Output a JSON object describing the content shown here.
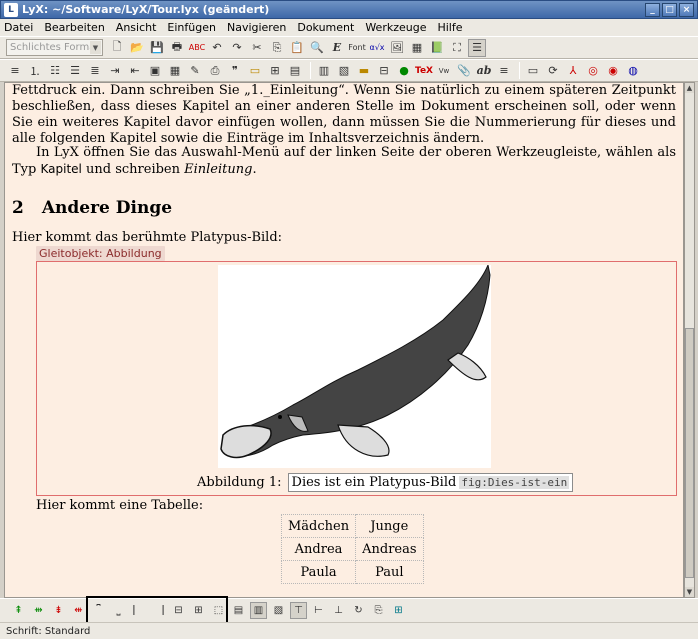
{
  "window": {
    "title": "LyX: ~/Software/LyX/Tour.lyx (geändert)",
    "controls": [
      "_",
      "□",
      "×"
    ]
  },
  "menu": [
    "Datei",
    "Bearbeiten",
    "Ansicht",
    "Einfügen",
    "Navigieren",
    "Dokument",
    "Werkzeuge",
    "Hilfe"
  ],
  "toolbar": {
    "style_combo": "Schlichtes Format",
    "row1_icons": [
      "new-file-icon",
      "open-file-icon",
      "save-icon",
      "print-icon",
      "spellcheck-icon",
      "undo-icon",
      "redo-icon",
      "cut-icon",
      "copy-icon",
      "paste-icon",
      "find-replace-icon",
      "emphasis-icon",
      "font-icon",
      "math-icon",
      "image-icon",
      "table-icon",
      "book-icon",
      "fullscreen-icon",
      "toc-icon"
    ],
    "row2_icons": [
      "bullet-list-icon",
      "numbered-list-icon",
      "description-list-icon",
      "align-left-icon",
      "align-center-icon",
      "indent-icon",
      "outdent-icon",
      "insert-figure-icon",
      "insert-table-icon",
      "insert-note-icon",
      "insert-link-icon",
      "insert-citation-icon",
      "insert-url-icon",
      "insert-label-icon",
      "insert-footnote-icon",
      "insert-margin-icon",
      "insert-index-icon",
      "paragraph-icon",
      "view-dvi-icon",
      "insert-ert-icon",
      "tex-icon",
      "view-icon",
      "attach-icon",
      "ab-icon",
      "list-icon",
      "view-pdf-icon",
      "update-icon",
      "pdf-icon",
      "ps-icon",
      "xhtml-icon",
      "update-output-icon"
    ]
  },
  "document": {
    "para1_pre": "Fettdruck ein. Dann schreiben Sie „1._Einleitung“. Wenn Sie natürlich zu einem späteren Zeitpunkt beschließen, dass dieses Kapitel an einer anderen Stelle im Dokument erscheinen soll, oder wenn Sie ein weiteres Kapitel davor einfügen wollen, dann müssen Sie die Nummerierung für dieses und alle folgenden Kapitel sowie die Einträge im Inhaltsverzeichnis ändern.",
    "para2_pre": "In LyX öffnen Sie das Auswahl-Menü auf der linken Seite der oberen Werkzeugleiste, wählen als Typ ",
    "para2_kw": "Kapitel",
    "para2_mid": " und schreiben ",
    "para2_em": "Einleitung",
    "para2_end": ".",
    "section_number": "2",
    "section_title": "Andere Dinge",
    "para3": "Hier kommt das berühmte Platypus-Bild:",
    "float_label": "Gleitobjekt: Abbildung",
    "caption_prefix": "Abbildung 1:",
    "caption_text": "Dies ist ein Platypus-Bild",
    "caption_label": "fig:Dies-ist-ein",
    "para4": "Hier kommt eine Tabelle:",
    "table": [
      [
        "Mädchen",
        "Junge"
      ],
      [
        "Andrea",
        "Andreas"
      ],
      [
        "Paula",
        "Paul"
      ]
    ]
  },
  "bottom_toolbar_icons": [
    "insert-row-icon",
    "insert-column-icon",
    "delete-row-icon",
    "delete-column-icon",
    "border-top-icon",
    "border-bottom-icon",
    "border-left-icon",
    "border-right-icon",
    "border-inner-icon",
    "border-all-icon",
    "border-none-icon",
    "align-left-icon",
    "align-center-icon",
    "align-right-icon",
    "valign-top-icon",
    "valign-middle-icon",
    "valign-bottom-icon",
    "rotate-icon",
    "longtable-icon",
    "table-settings-icon"
  ],
  "status": "Schrift: Standard"
}
